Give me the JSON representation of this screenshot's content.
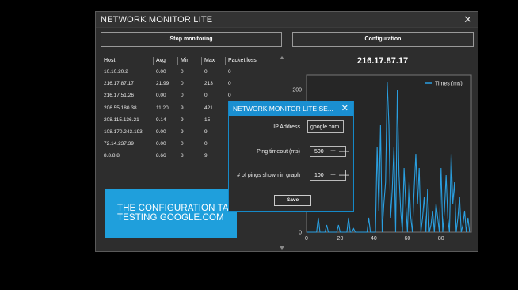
{
  "window": {
    "title": "NETWORK MONITOR LITE",
    "close_glyph": "✕"
  },
  "toolbar": {
    "stop_label": "Stop monitoring",
    "config_label": "Configuration"
  },
  "table": {
    "headers": [
      "Host",
      "Avg",
      "Min",
      "Max",
      "Packet loss"
    ],
    "rows": [
      [
        "10.10.20.2",
        "0.00",
        "0",
        "0",
        "0"
      ],
      [
        "216.17.87.17",
        "21.99",
        "0",
        "213",
        "0"
      ],
      [
        "216.17.51.26",
        "0.00",
        "0",
        "0",
        "0"
      ],
      [
        "206.55.180.38",
        "11.20",
        "9",
        "421",
        "0"
      ],
      [
        "208.115.136.21",
        "9.14",
        "9",
        "15",
        "0"
      ],
      [
        "108.170.243.193",
        "9.00",
        "9",
        "9",
        "0"
      ],
      [
        "72.14.237.39",
        "0.00",
        "0",
        "0",
        "1"
      ],
      [
        "8.8.8.8",
        "8.66",
        "8",
        "9",
        "0"
      ]
    ]
  },
  "graph": {
    "title": "216.17.87.17",
    "chart_data": {
      "type": "line",
      "series": [
        {
          "name": "Times (ms)",
          "x": [
            0,
            1,
            2,
            3,
            4,
            5,
            6,
            7,
            8,
            9,
            10,
            11,
            12,
            13,
            14,
            15,
            16,
            17,
            18,
            19,
            20,
            21,
            22,
            23,
            24,
            25,
            26,
            27,
            28,
            29,
            30,
            31,
            32,
            33,
            34,
            35,
            36,
            37,
            38,
            39,
            40,
            41,
            42,
            43,
            44,
            45,
            46,
            47,
            48,
            49,
            50,
            51,
            52,
            53,
            54,
            55,
            56,
            57,
            58,
            59,
            60,
            61,
            62,
            63,
            64,
            65,
            66,
            67,
            68,
            69,
            70,
            71,
            72,
            73,
            74,
            75,
            76,
            77,
            78,
            79,
            80,
            81,
            82,
            83,
            84,
            85,
            86,
            87,
            88,
            89,
            90,
            91,
            92,
            93,
            94,
            95,
            96,
            97
          ],
          "values": [
            0,
            0,
            0,
            0,
            0,
            0,
            0,
            20,
            0,
            0,
            0,
            0,
            10,
            0,
            0,
            0,
            0,
            0,
            0,
            10,
            0,
            0,
            0,
            0,
            0,
            20,
            0,
            0,
            5,
            0,
            0,
            0,
            0,
            0,
            0,
            0,
            0,
            20,
            0,
            0,
            0,
            0,
            120,
            30,
            150,
            0,
            40,
            70,
            210,
            150,
            20,
            60,
            120,
            0,
            200,
            80,
            30,
            0,
            90,
            40,
            0,
            70,
            20,
            0,
            60,
            110,
            40,
            90,
            0,
            20,
            50,
            0,
            60,
            0,
            10,
            30,
            0,
            40,
            20,
            0,
            90,
            0,
            30,
            80,
            20,
            0,
            110,
            40,
            70,
            0,
            20,
            50,
            0,
            10,
            30,
            0,
            20,
            0
          ]
        }
      ],
      "xlim": [
        0,
        98
      ],
      "ylim": [
        0,
        220
      ],
      "xticks": [
        0,
        20,
        40,
        60,
        80
      ],
      "yticks": [
        0,
        100,
        200
      ],
      "line_color": "#2a9fe0",
      "legend": "top-right",
      "grid": false
    }
  },
  "overlay": {
    "line1": "THE CONFIGURATION TAB",
    "line2": "TESTING GOOGLE.COM"
  },
  "dialog": {
    "title": "NETWORK MONITOR LITE SE...",
    "close_glyph": "✕",
    "ip_label": "IP Address",
    "ip_value": "google.com",
    "timeout_label": "Ping timeout (ms)",
    "timeout_value": "500",
    "pings_label": "# of pings shown in graph",
    "pings_value": "100",
    "plus_glyph": "+",
    "minus_glyph": "—",
    "save_label": "Save"
  }
}
